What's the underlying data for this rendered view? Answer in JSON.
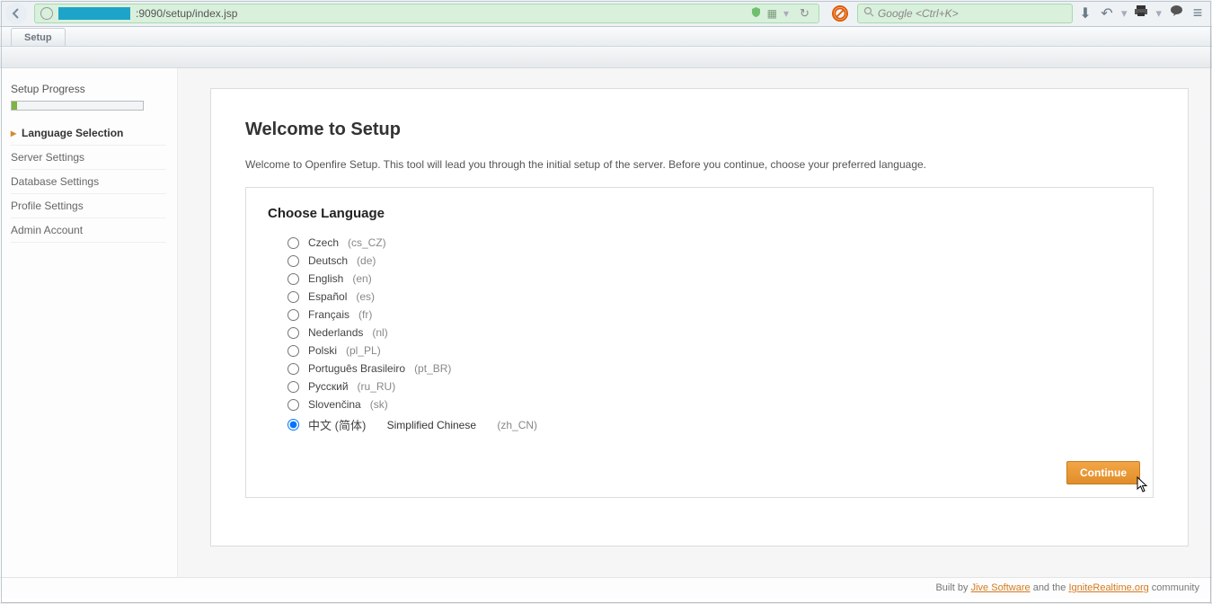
{
  "browser": {
    "url_suffix": ":9090/setup/index.jsp",
    "search_placeholder": "Google <Ctrl+K>"
  },
  "tab": {
    "label": "Setup"
  },
  "sidebar": {
    "title": "Setup Progress",
    "items": [
      {
        "label": "Language Selection",
        "active": true
      },
      {
        "label": "Server Settings",
        "active": false
      },
      {
        "label": "Database Settings",
        "active": false
      },
      {
        "label": "Profile Settings",
        "active": false
      },
      {
        "label": "Admin Account",
        "active": false
      }
    ]
  },
  "page": {
    "title": "Welcome to Setup",
    "intro": "Welcome to Openfire Setup. This tool will lead you through the initial setup of the server. Before you continue, choose your preferred language.",
    "choose_heading": "Choose Language",
    "continue_label": "Continue"
  },
  "languages": [
    {
      "native": "Czech",
      "code": "(cs_CZ)",
      "selected": false
    },
    {
      "native": "Deutsch",
      "code": "(de)",
      "selected": false
    },
    {
      "native": "English",
      "code": "(en)",
      "selected": false
    },
    {
      "native": "Español",
      "code": "(es)",
      "selected": false
    },
    {
      "native": "Français",
      "code": "(fr)",
      "selected": false
    },
    {
      "native": "Nederlands",
      "code": "(nl)",
      "selected": false
    },
    {
      "native": "Polski",
      "code": "(pl_PL)",
      "selected": false
    },
    {
      "native": "Português Brasileiro",
      "code": "(pt_BR)",
      "selected": false
    },
    {
      "native": "Русский",
      "code": "(ru_RU)",
      "selected": false
    },
    {
      "native": "Slovenčina",
      "code": "(sk)",
      "selected": false
    },
    {
      "native": "中文 (简体)",
      "en": "Simplified Chinese",
      "code": "(zh_CN)",
      "selected": true
    }
  ],
  "footer": {
    "prefix": "Built by ",
    "link1": "Jive Software",
    "mid": " and the ",
    "link2": "IgniteRealtime.org",
    "suffix": " community"
  }
}
